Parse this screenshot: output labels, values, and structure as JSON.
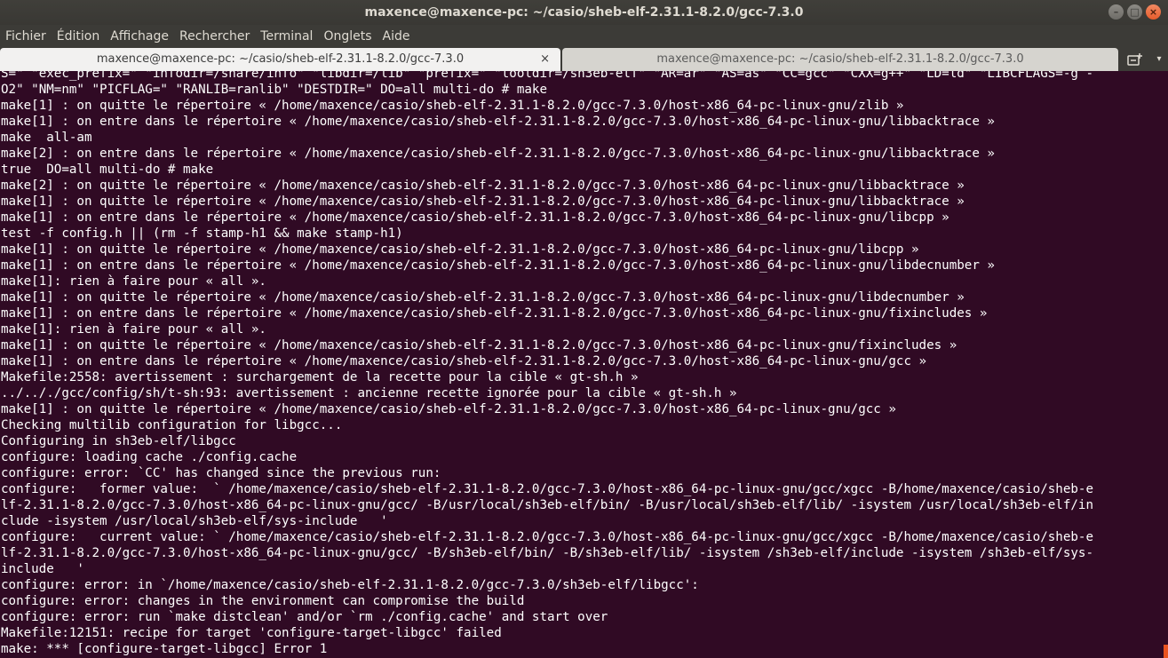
{
  "window": {
    "title": "maxence@maxence-pc: ~/casio/sheb-elf-2.31.1-8.2.0/gcc-7.3.0",
    "buttons": {
      "minimize": "–",
      "maximize": "□",
      "close": "×"
    }
  },
  "menubar": {
    "items": [
      "Fichier",
      "Édition",
      "Affichage",
      "Rechercher",
      "Terminal",
      "Onglets",
      "Aide"
    ]
  },
  "tabs": [
    {
      "label": "maxence@maxence-pc: ~/casio/sheb-elf-2.31.1-8.2.0/gcc-7.3.0",
      "close": "×",
      "active": true
    },
    {
      "label": "maxence@maxence-pc: ~/casio/sheb-elf-2.31.1-8.2.0/gcc-7.3.0",
      "active": false
    }
  ],
  "tabbar": {
    "menu_glyph": "▾"
  },
  "terminal": {
    "lines": [
      "S=\" \"exec_prefix=\" \"infodir=/share/info\" \"libdir=/lib\" \"prefix=\" \"tooldir=/sh3eb-elf\" \"AR=ar\" \"AS=as\" \"CC=gcc\" \"CXX=g++\" \"LD=ld\" \"LIBCFLAGS=-g -",
      "O2\" \"NM=nm\" \"PICFLAG=\" \"RANLIB=ranlib\" \"DESTDIR=\" DO=all multi-do # make",
      "make[1] : on quitte le répertoire « /home/maxence/casio/sheb-elf-2.31.1-8.2.0/gcc-7.3.0/host-x86_64-pc-linux-gnu/zlib »",
      "make[1] : on entre dans le répertoire « /home/maxence/casio/sheb-elf-2.31.1-8.2.0/gcc-7.3.0/host-x86_64-pc-linux-gnu/libbacktrace »",
      "make  all-am",
      "make[2] : on entre dans le répertoire « /home/maxence/casio/sheb-elf-2.31.1-8.2.0/gcc-7.3.0/host-x86_64-pc-linux-gnu/libbacktrace »",
      "true  DO=all multi-do # make",
      "make[2] : on quitte le répertoire « /home/maxence/casio/sheb-elf-2.31.1-8.2.0/gcc-7.3.0/host-x86_64-pc-linux-gnu/libbacktrace »",
      "make[1] : on quitte le répertoire « /home/maxence/casio/sheb-elf-2.31.1-8.2.0/gcc-7.3.0/host-x86_64-pc-linux-gnu/libbacktrace »",
      "make[1] : on entre dans le répertoire « /home/maxence/casio/sheb-elf-2.31.1-8.2.0/gcc-7.3.0/host-x86_64-pc-linux-gnu/libcpp »",
      "test -f config.h || (rm -f stamp-h1 && make stamp-h1)",
      "make[1] : on quitte le répertoire « /home/maxence/casio/sheb-elf-2.31.1-8.2.0/gcc-7.3.0/host-x86_64-pc-linux-gnu/libcpp »",
      "make[1] : on entre dans le répertoire « /home/maxence/casio/sheb-elf-2.31.1-8.2.0/gcc-7.3.0/host-x86_64-pc-linux-gnu/libdecnumber »",
      "make[1]: rien à faire pour « all ».",
      "make[1] : on quitte le répertoire « /home/maxence/casio/sheb-elf-2.31.1-8.2.0/gcc-7.3.0/host-x86_64-pc-linux-gnu/libdecnumber »",
      "make[1] : on entre dans le répertoire « /home/maxence/casio/sheb-elf-2.31.1-8.2.0/gcc-7.3.0/host-x86_64-pc-linux-gnu/fixincludes »",
      "make[1]: rien à faire pour « all ».",
      "make[1] : on quitte le répertoire « /home/maxence/casio/sheb-elf-2.31.1-8.2.0/gcc-7.3.0/host-x86_64-pc-linux-gnu/fixincludes »",
      "make[1] : on entre dans le répertoire « /home/maxence/casio/sheb-elf-2.31.1-8.2.0/gcc-7.3.0/host-x86_64-pc-linux-gnu/gcc »",
      "Makefile:2558: avertissement : surchargement de la recette pour la cible « gt-sh.h »",
      "../.././gcc/config/sh/t-sh:93: avertissement : ancienne recette ignorée pour la cible « gt-sh.h »",
      "make[1] : on quitte le répertoire « /home/maxence/casio/sheb-elf-2.31.1-8.2.0/gcc-7.3.0/host-x86_64-pc-linux-gnu/gcc »",
      "Checking multilib configuration for libgcc...",
      "Configuring in sh3eb-elf/libgcc",
      "configure: loading cache ./config.cache",
      "configure: error: `CC' has changed since the previous run:",
      "configure:   former value:  ` /home/maxence/casio/sheb-elf-2.31.1-8.2.0/gcc-7.3.0/host-x86_64-pc-linux-gnu/gcc/xgcc -B/home/maxence/casio/sheb-e",
      "lf-2.31.1-8.2.0/gcc-7.3.0/host-x86_64-pc-linux-gnu/gcc/ -B/usr/local/sh3eb-elf/bin/ -B/usr/local/sh3eb-elf/lib/ -isystem /usr/local/sh3eb-elf/in",
      "clude -isystem /usr/local/sh3eb-elf/sys-include   '",
      "configure:   current value: ` /home/maxence/casio/sheb-elf-2.31.1-8.2.0/gcc-7.3.0/host-x86_64-pc-linux-gnu/gcc/xgcc -B/home/maxence/casio/sheb-e",
      "lf-2.31.1-8.2.0/gcc-7.3.0/host-x86_64-pc-linux-gnu/gcc/ -B/sh3eb-elf/bin/ -B/sh3eb-elf/lib/ -isystem /sh3eb-elf/include -isystem /sh3eb-elf/sys-",
      "include   '",
      "configure: error: in `/home/maxence/casio/sheb-elf-2.31.1-8.2.0/gcc-7.3.0/sh3eb-elf/libgcc':",
      "configure: error: changes in the environment can compromise the build",
      "configure: error: run `make distclean' and/or `rm ./config.cache' and start over",
      "Makefile:12151: recipe for target 'configure-target-libgcc' failed",
      "make: *** [configure-target-libgcc] Error 1"
    ]
  },
  "colors": {
    "terminal_bg": "#300a24",
    "terminal_fg": "#ffffff",
    "chrome_bg": "#3c3b37",
    "active_tab_bg": "#f2f1f0",
    "inactive_tab_bg": "#d6d4cf",
    "accent": "#e95420"
  }
}
